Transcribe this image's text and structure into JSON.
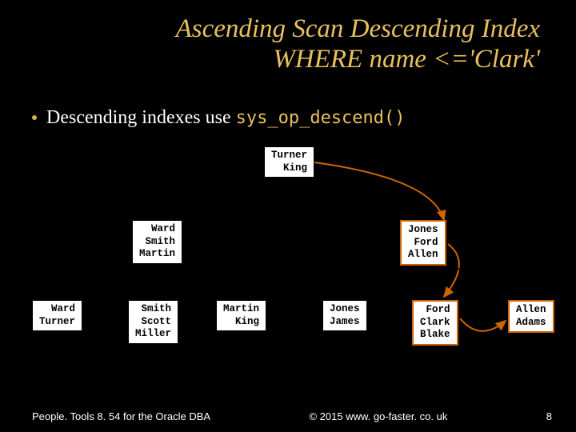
{
  "title_line1": "Ascending Scan Descending Index",
  "title_line2": "WHERE name <='Clark'",
  "bullet": "Descending indexes use ",
  "bullet_code": "sys_op_descend()",
  "nodes": {
    "root": "Turner\nKing",
    "mid_left": "Ward\nSmith\nMartin",
    "mid_right": "Jones\nFord\nAllen",
    "leaf1": "Ward\nTurner",
    "leaf2": "Smith\nScott\nMiller",
    "leaf3": "Martin\nKing",
    "leaf4": "Jones\nJames",
    "leaf5": "Ford\nClark\nBlake",
    "leaf6": "Allen\nAdams"
  },
  "footer": {
    "left": "People. Tools 8. 54 for the Oracle DBA",
    "center": "© 2015 www. go-faster. co. uk",
    "right": "8"
  },
  "chart_data": {
    "type": "tree-diagram",
    "description": "B-tree index diagram for descending index scan WHERE name <= 'Clark'",
    "root": [
      "Turner",
      "King"
    ],
    "level2": [
      {
        "keys": [
          "Ward",
          "Smith",
          "Martin"
        ],
        "highlighted": false
      },
      {
        "keys": [
          "Jones",
          "Ford",
          "Allen"
        ],
        "highlighted": true
      }
    ],
    "leaves": [
      {
        "keys": [
          "Ward",
          "Turner"
        ],
        "highlighted": false
      },
      {
        "keys": [
          "Smith",
          "Scott",
          "Miller"
        ],
        "highlighted": false
      },
      {
        "keys": [
          "Martin",
          "King"
        ],
        "highlighted": false
      },
      {
        "keys": [
          "Jones",
          "James"
        ],
        "highlighted": false
      },
      {
        "keys": [
          "Ford",
          "Clark",
          "Blake"
        ],
        "highlighted": true
      },
      {
        "keys": [
          "Allen",
          "Adams"
        ],
        "highlighted": true
      }
    ],
    "scan_direction": "ascending (left-to-right leaf traversal)",
    "highlighted_path": "root -> right branch -> rightmost leaves"
  }
}
